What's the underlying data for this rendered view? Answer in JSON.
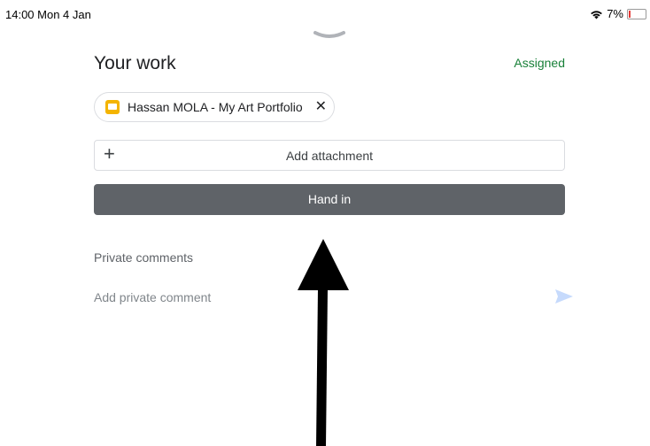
{
  "status_bar": {
    "time_date": "14:00  Mon 4 Jan",
    "battery_percent_text": "7%",
    "battery_level": 0.07,
    "wifi_icon": "wifi-icon",
    "battery_icon": "battery-icon"
  },
  "sheet": {
    "grabber_icon": "chevron-down-icon",
    "title": "Your work",
    "status": "Assigned",
    "status_color": "#188038"
  },
  "attachment": {
    "icon": "google-slides-icon",
    "label": "Hassan MOLA - My Art Portfolio",
    "remove_icon": "close-icon"
  },
  "add_attachment": {
    "icon": "plus-icon",
    "label": "Add attachment"
  },
  "hand_in": {
    "label": "Hand in",
    "color": "#5f6368"
  },
  "private_comments": {
    "title": "Private comments",
    "placeholder": "Add private comment",
    "send_icon": "send-icon"
  },
  "annotation": {
    "icon": "arrow-up-icon"
  }
}
